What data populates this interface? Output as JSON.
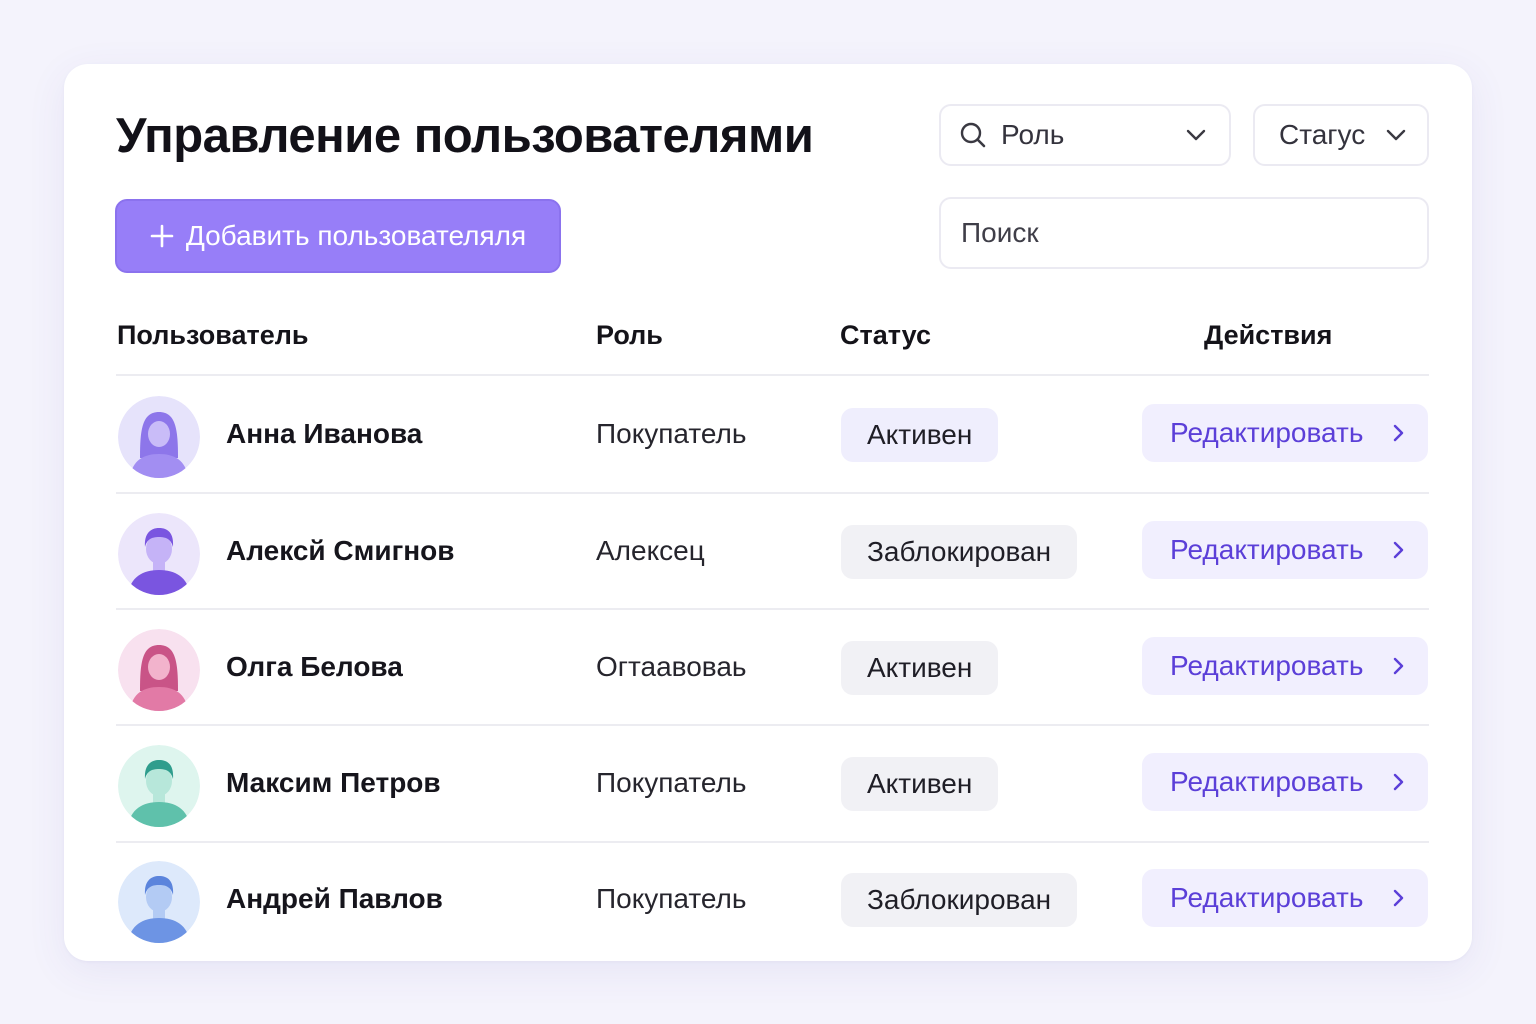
{
  "header": {
    "title": "Управление пользователями",
    "add_button_label": "Добавить пользователяля"
  },
  "filters": {
    "role_label": "Роль",
    "status_label": "Стагус",
    "search_placeholder": "Поиск"
  },
  "table": {
    "columns": [
      "Пользователь",
      "Роль",
      "Статус",
      "Действия"
    ],
    "rows": [
      {
        "name": "Анна Иванова",
        "role": "Покупатель",
        "status": "Активен",
        "action": "Редактировать",
        "avatar": "female-avatar-icon",
        "avatar_bg": "#e6e3fb",
        "avatar_fg": "#a28ef2",
        "avatar_hair": "#8d76ea"
      },
      {
        "name": "Алексй Смигнов",
        "role": "Алексец",
        "status": "Заблокирован",
        "action": "Редактировать",
        "avatar": "male-avatar-icon",
        "avatar_bg": "#ece6fb",
        "avatar_fg": "#9b7ef0",
        "avatar_hair": "#7a55e0"
      },
      {
        "name": "Олга Белова",
        "role": "Огтаавоваь",
        "status": "Активен",
        "action": "Редактировать",
        "avatar": "female-avatar-icon",
        "avatar_bg": "#f8e1ef",
        "avatar_fg": "#e27aa6",
        "avatar_hair": "#c95487"
      },
      {
        "name": "Максим Петров",
        "role": "Покупатель",
        "status": "Активен",
        "action": "Редактировать",
        "avatar": "male-avatar-icon",
        "avatar_bg": "#def5ee",
        "avatar_fg": "#8fd5c3",
        "avatar_hair": "#2f9d8d"
      },
      {
        "name": "Андрей Павлов",
        "role": "Покупатель",
        "status": "Заблокирован",
        "action": "Редактировать",
        "avatar": "male-avatar-icon",
        "avatar_bg": "#dde9fb",
        "avatar_fg": "#8eb0ee",
        "avatar_hair": "#5b84dc"
      }
    ]
  },
  "colors": {
    "accent": "#977ef8",
    "accent_text": "#5b3fd8",
    "page_background": "#f4f3fc"
  }
}
